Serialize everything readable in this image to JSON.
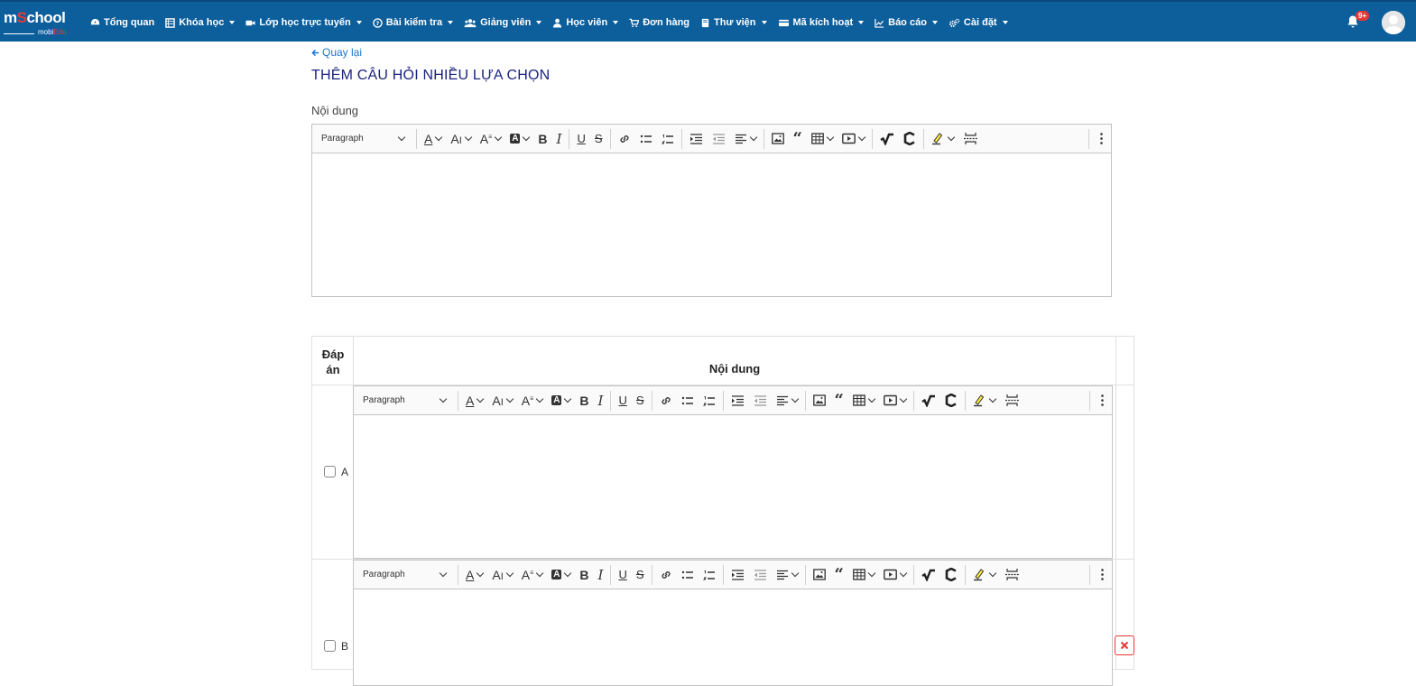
{
  "brand": {
    "logo_main_a": "m",
    "logo_main_b": "S",
    "logo_main_c": "chool",
    "logo_sub_a": "mobi",
    "logo_sub_b": "Edu"
  },
  "nav": {
    "items": [
      {
        "label": "Tổng quan",
        "icon": "dashboard-icon",
        "dropdown": false
      },
      {
        "label": "Khóa học",
        "icon": "table-icon",
        "dropdown": true
      },
      {
        "label": "Lớp học trực tuyến",
        "icon": "video-icon",
        "dropdown": true
      },
      {
        "label": "Bài kiểm tra",
        "icon": "question-circle-icon",
        "dropdown": true
      },
      {
        "label": "Giảng viên",
        "icon": "users-icon",
        "dropdown": true
      },
      {
        "label": "Học viên",
        "icon": "user-icon",
        "dropdown": true
      },
      {
        "label": "Đơn hàng",
        "icon": "cart-icon",
        "dropdown": false
      },
      {
        "label": "Thư viện",
        "icon": "book-icon",
        "dropdown": true
      },
      {
        "label": "Mã kích hoạt",
        "icon": "card-icon",
        "dropdown": true
      },
      {
        "label": "Báo cáo",
        "icon": "chart-icon",
        "dropdown": true
      },
      {
        "label": "Cài đặt",
        "icon": "gears-icon",
        "dropdown": true
      }
    ],
    "notification_badge": "9+"
  },
  "page": {
    "back_label": "Quay lại",
    "title": "THÊM CÂU HỎI NHIỀU LỰA CHỌN",
    "content_label": "Nội dung"
  },
  "editor": {
    "paragraph_label": "Paragraph"
  },
  "answers": {
    "col_answer": "Đáp án",
    "col_content": "Nội dung",
    "options": [
      {
        "letter": "A",
        "checked": false
      },
      {
        "letter": "B",
        "checked": false
      }
    ]
  },
  "colors": {
    "navbar": "#0d5f9c",
    "title": "#1a237e",
    "link": "#1976d2",
    "danger": "#e53935"
  }
}
